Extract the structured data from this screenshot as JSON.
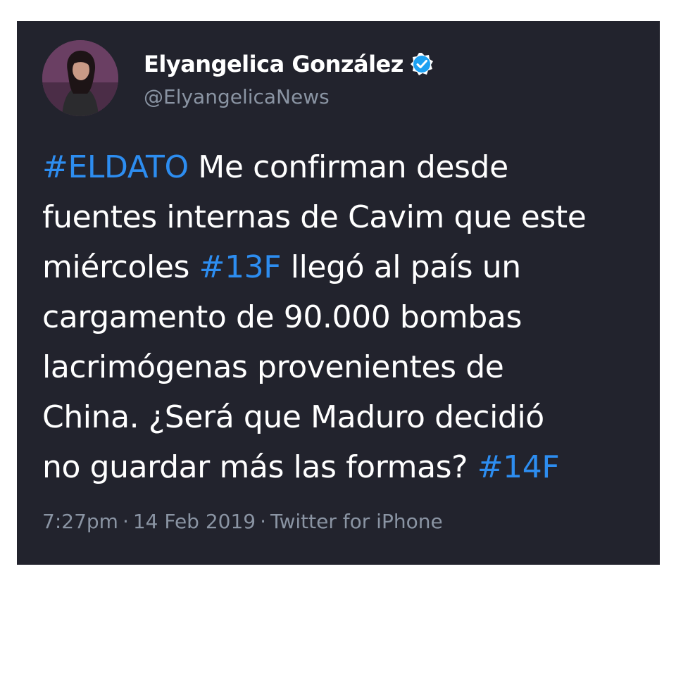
{
  "tweet": {
    "author": {
      "display_name": "Elyangelica González",
      "handle": "@ElyangelicaNews",
      "verified": true,
      "avatar_icon": "profile-photo"
    },
    "body_lines": [
      {
        "hashtag": "#ELDATO",
        "text": " Me confirman desde"
      },
      {
        "text": "fuentes internas de Cavim que este"
      },
      {
        "text": "miércoles ",
        "hashtag": "#13F",
        "text_after": " llegó al país un"
      },
      {
        "text": "cargamento de 90.000 bombas"
      },
      {
        "text": "lacrimógenas provenientes de"
      },
      {
        "text": "China. ¿Será que Maduro decidió"
      },
      {
        "text": "no guardar más las formas? ",
        "hashtag": "#14F"
      }
    ],
    "meta": {
      "time": "7:27pm",
      "separator": "·",
      "date": "14 Feb 2019",
      "source": "Twitter for iPhone"
    }
  },
  "colors": {
    "card_background": "#22232d",
    "text": "#ffffff",
    "hashtag": "#2d8df0",
    "muted": "#8a94a3",
    "verified_badge": "#1da1f2"
  }
}
